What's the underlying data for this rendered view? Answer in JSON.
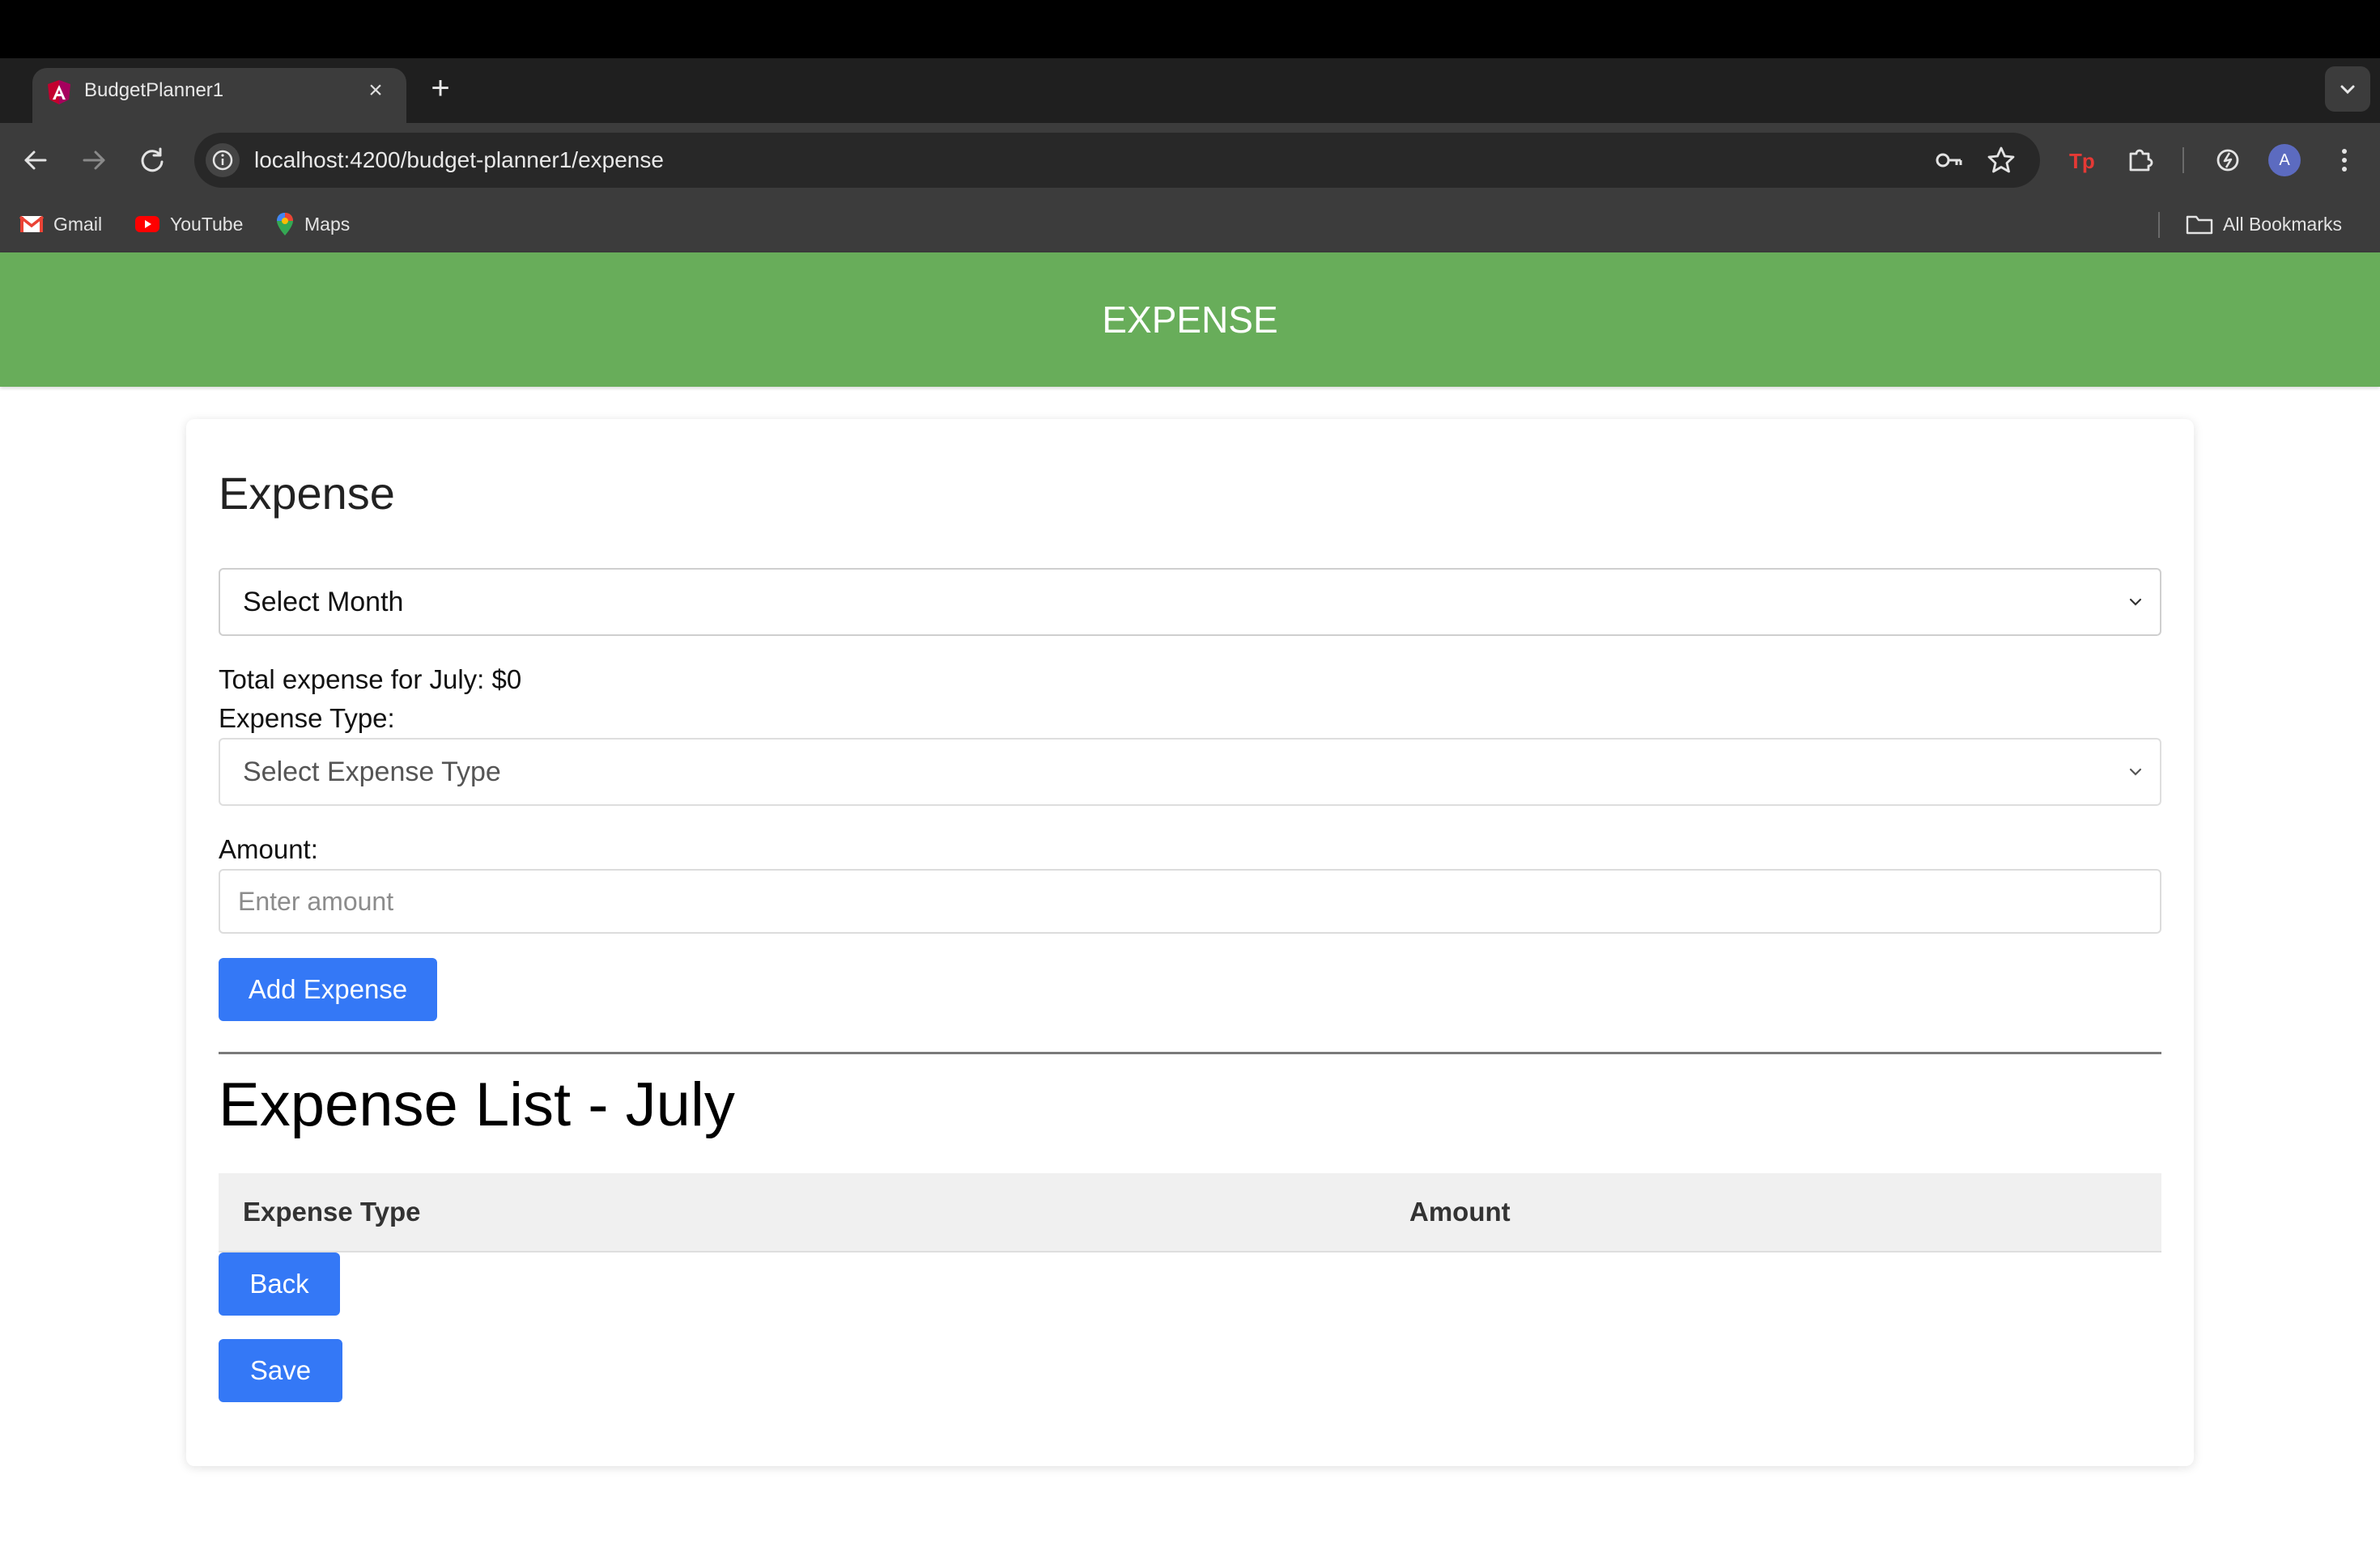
{
  "browser": {
    "tab_title": "BudgetPlanner1",
    "url": "localhost:4200/budget-planner1/expense",
    "avatar_letter": "A",
    "bookmarks": [
      {
        "label": "Gmail",
        "icon": "gmail-icon"
      },
      {
        "label": "YouTube",
        "icon": "youtube-icon"
      },
      {
        "label": "Maps",
        "icon": "maps-icon"
      }
    ],
    "all_bookmarks_label": "All Bookmarks"
  },
  "header": {
    "title": "EXPENSE",
    "color": "#68ad5a"
  },
  "form": {
    "title": "Expense",
    "month_select": {
      "selected": "Select Month"
    },
    "total_text": "Total expense for July: $0",
    "expense_type_label": "Expense Type:",
    "expense_type_select": {
      "selected": "Select Expense Type"
    },
    "amount_label": "Amount:",
    "amount_placeholder": "Enter amount",
    "add_button": "Add Expense"
  },
  "list": {
    "title": "Expense List - July",
    "columns": [
      "Expense Type",
      "Amount"
    ],
    "rows": []
  },
  "actions": {
    "back_button": "Back",
    "save_button": "Save"
  },
  "colors": {
    "primary_button": "#3478f6"
  }
}
